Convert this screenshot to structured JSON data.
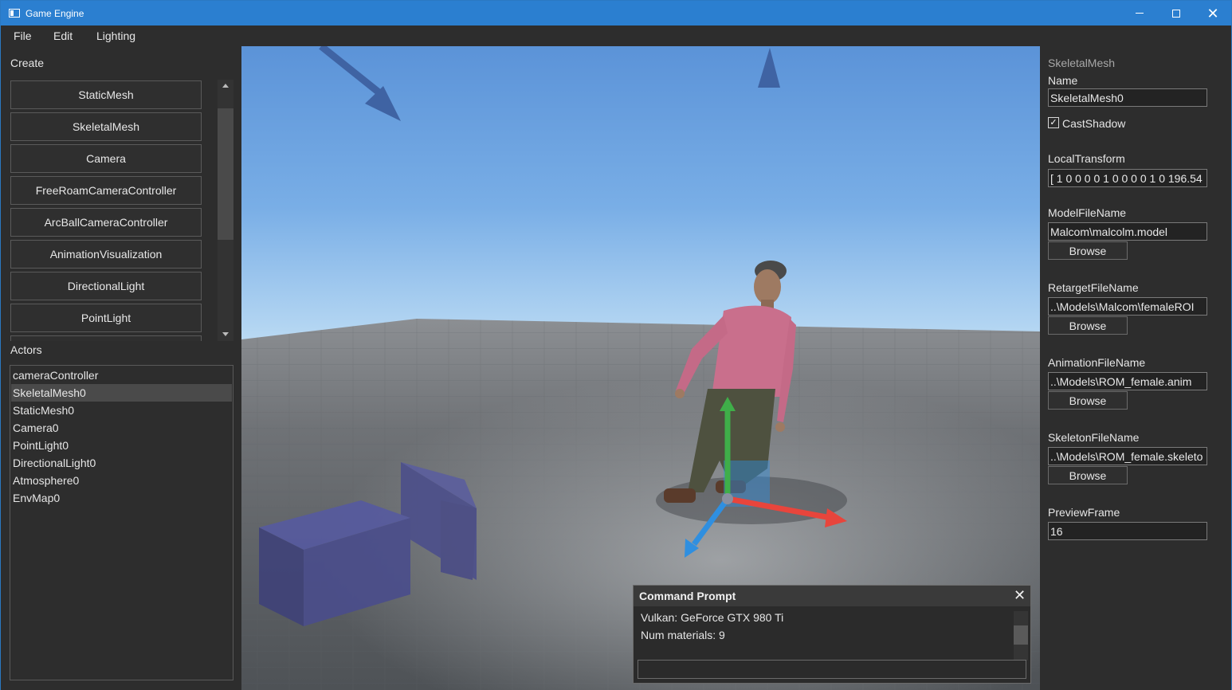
{
  "window": {
    "title": "Game Engine"
  },
  "menu": {
    "file": "File",
    "edit": "Edit",
    "lighting": "Lighting"
  },
  "create": {
    "label": "Create",
    "buttons": [
      "StaticMesh",
      "SkeletalMesh",
      "Camera",
      "FreeRoamCameraController",
      "ArcBallCameraController",
      "AnimationVisualization",
      "DirectionalLight",
      "PointLight"
    ]
  },
  "actors": {
    "label": "Actors",
    "items": [
      "cameraController",
      "SkeletalMesh0",
      "StaticMesh0",
      "Camera0",
      "PointLight0",
      "DirectionalLight0",
      "Atmosphere0",
      "EnvMap0"
    ],
    "selected": "SkeletalMesh0"
  },
  "command_prompt": {
    "title": "Command Prompt",
    "lines": [
      "Vulkan: GeForce GTX 980 Ti",
      "Num materials: 9"
    ],
    "input": ""
  },
  "properties": {
    "header": "SkeletalMesh",
    "name_label": "Name",
    "name_value": "SkeletalMesh0",
    "cast_shadow_label": "CastShadow",
    "cast_shadow_checked": true,
    "check_mark": "✓",
    "local_transform_label": "LocalTransform",
    "local_transform_value": "[ 1 0 0 0 0 1 0 0 0 0 1 0 196.54",
    "model_label": "ModelFileName",
    "model_value": "Malcom\\malcolm.model",
    "retarget_label": "RetargetFileName",
    "retarget_value": "..\\Models\\Malcom\\femaleROI",
    "animation_label": "AnimationFileName",
    "animation_value": "..\\Models\\ROM_female.anim",
    "skeleton_label": "SkeletonFileName",
    "skeleton_value": "..\\Models\\ROM_female.skeleto",
    "preview_label": "PreviewFrame",
    "preview_value": "16",
    "browse_label": "Browse"
  },
  "colors": {
    "titlebar": "#2b7fd0",
    "panel": "#2d2d2d",
    "gizmo_x": "#e8453c",
    "gizmo_y": "#3fae49",
    "gizmo_z": "#2f8fe0"
  },
  "window_controls": {
    "close_glyph": "✕"
  }
}
